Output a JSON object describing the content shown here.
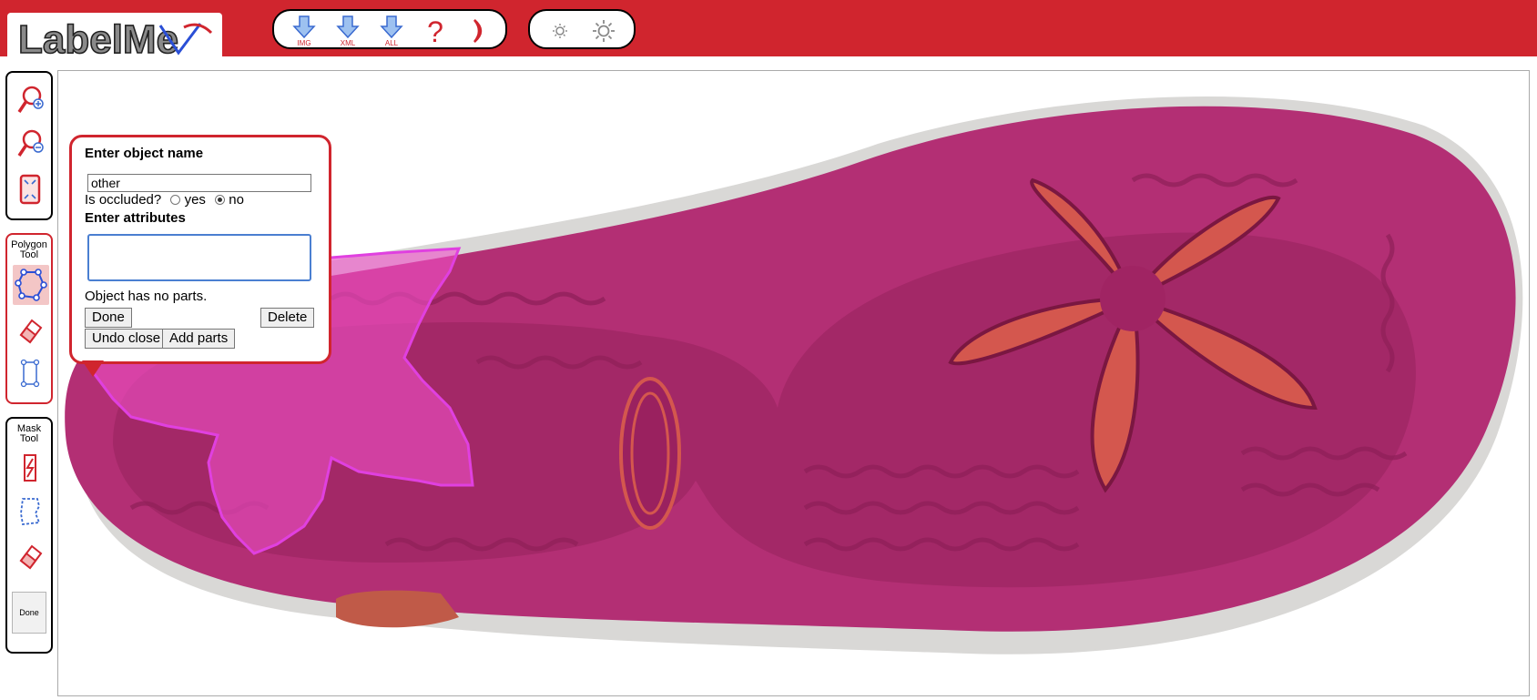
{
  "app": {
    "logo_text": "LabelMe"
  },
  "toolbar": {
    "buttons": [
      {
        "name": "download-image-button",
        "icon": "download-arrow-icon",
        "label": "IMG"
      },
      {
        "name": "download-xml-button",
        "icon": "download-arrow-icon",
        "label": "XML"
      },
      {
        "name": "download-all-button",
        "icon": "download-arrow-icon",
        "label": "ALL"
      },
      {
        "name": "help-button",
        "icon": "question-mark-icon",
        "label": ""
      },
      {
        "name": "signout-button",
        "icon": "crescent-icon",
        "label": ""
      }
    ],
    "brightness": [
      {
        "name": "decrease-brightness-button",
        "icon": "sun-small-icon"
      },
      {
        "name": "increase-brightness-button",
        "icon": "sun-large-icon"
      }
    ]
  },
  "side": {
    "zoom": [
      "zoom-in-icon",
      "zoom-out-icon",
      "fit-to-screen-icon"
    ],
    "polygon_tool": {
      "title_line1": "Polygon",
      "title_line2": "Tool"
    },
    "mask_tool": {
      "title_line1": "Mask",
      "title_line2": "Tool",
      "done_label": "Done"
    }
  },
  "popup": {
    "name_heading": "Enter object name",
    "name_value": "other",
    "occluded_label": "Is occluded?",
    "occluded_yes": "yes",
    "occluded_no": "no",
    "occluded_selected": "no",
    "attributes_heading": "Enter attributes",
    "attributes_value": "",
    "parts_text": "Object has no parts.",
    "done_button": "Done",
    "delete_button": "Delete",
    "undo_close_button": "Undo close",
    "add_parts_button": "Add parts"
  },
  "colors": {
    "brand_red": "#d0252e",
    "polygon_outline": "#e040e0",
    "polygon_fill": "#f050c8",
    "sole": "#b32f74"
  }
}
